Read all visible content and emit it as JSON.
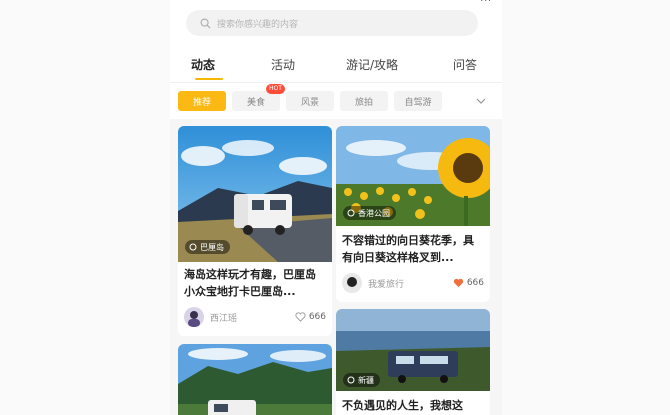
{
  "status": {
    "right_text": "..."
  },
  "search": {
    "placeholder": "搜索你感兴趣的内容"
  },
  "tabs": [
    {
      "label": "动态",
      "active": true
    },
    {
      "label": "活动"
    },
    {
      "label": "游记/攻略"
    },
    {
      "label": "问答"
    }
  ],
  "chips": [
    {
      "label": "推荐",
      "active": true
    },
    {
      "label": "美食",
      "badge": "HOT"
    },
    {
      "label": "风景"
    },
    {
      "label": "旅拍"
    },
    {
      "label": "自驾游"
    }
  ],
  "cards": [
    {
      "badge": "巴厘岛",
      "title": "海岛这样玩才有趣，巴厘岛小众宝地打卡巴厘岛...",
      "user": "西江瑶",
      "likes": "666",
      "liked": false
    },
    {
      "badge": "香港公园",
      "title": "不容错过的向日葵花季，具有向日葵这样格叉到...",
      "user": "我爱旅行",
      "likes": "666",
      "liked": true
    },
    {
      "badge": "新疆",
      "title": "不负遇见的人生，我想这",
      "user": "",
      "likes": ""
    },
    {
      "badge": "",
      "title": "",
      "user": "",
      "likes": ""
    }
  ],
  "colors": {
    "accent": "#fcb813",
    "hot": "#ff4d3a",
    "heart": "#f0703c"
  }
}
